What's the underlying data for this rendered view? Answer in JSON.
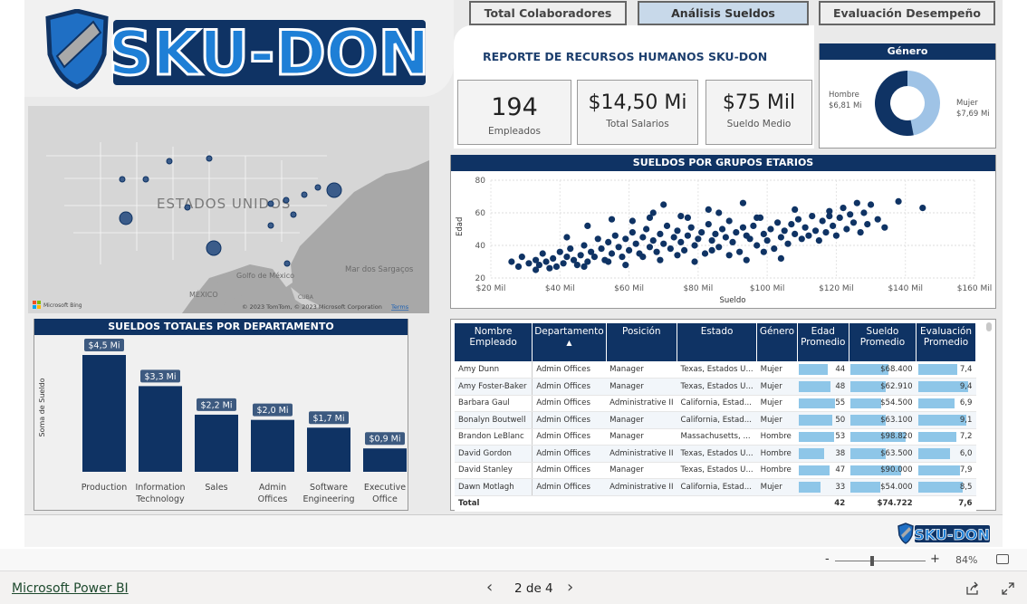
{
  "nav_tabs": [
    {
      "label": "Total Colaboradores",
      "active": false
    },
    {
      "label": "Análisis Sueldos",
      "active": true
    },
    {
      "label": "Evaluación Desempeño",
      "active": false
    }
  ],
  "logo": {
    "text": "SKU-DON"
  },
  "report_title": "REPORTE DE RECURSOS HUMANOS SKU-DON",
  "kpis": [
    {
      "value": "194",
      "label": "Empleados"
    },
    {
      "value": "$14,50 Mi",
      "label": "Total Salarios"
    },
    {
      "value": "$75 Mil",
      "label": "Sueldo Medio"
    }
  ],
  "map": {
    "country_label": "ESTADOS UNIDOS",
    "gulf_label": "Golfo de\nMéxico",
    "sea_label": "Mar dos Sargaços",
    "mexico_label": "MÉXICO",
    "cuba_label": "CUBA",
    "attribution": "© 2023 TomTom, © 2023 Microsoft Corporation",
    "terms_link": "Terms",
    "bing_label": "Microsoft Bing",
    "water_color": "#a8a8a8",
    "land_color": "#d6d6d6"
  },
  "gender_chart": {
    "title": "Género",
    "slices": [
      {
        "name": "Hombre",
        "value_label": "$6,81 Mi",
        "value": 6.81,
        "color": "#9fc3e6"
      },
      {
        "name": "Mujer",
        "value_label": "$7,69 Mi",
        "value": 7.69,
        "color": "#0f3364"
      }
    ]
  },
  "chart_data": [
    {
      "type": "scatter",
      "title": "SUELDOS POR GRUPOS ETARIOS",
      "xlabel": "Sueldo",
      "ylabel": "Edad",
      "xlim": [
        20000,
        160000
      ],
      "ylim": [
        20,
        80
      ],
      "x_tick_labels": [
        "$20 Mil",
        "$40 Mil",
        "$60 Mil",
        "$80 Mil",
        "$100 Mil",
        "$120 Mil",
        "$140 Mil",
        "$160 Mil"
      ],
      "y_tick_labels": [
        "20",
        "40",
        "60",
        "80"
      ],
      "grid": true,
      "points": [
        [
          26000,
          30
        ],
        [
          28000,
          27
        ],
        [
          29000,
          33
        ],
        [
          31000,
          29
        ],
        [
          33000,
          31
        ],
        [
          34000,
          28
        ],
        [
          35000,
          35
        ],
        [
          36000,
          30
        ],
        [
          38000,
          32
        ],
        [
          39000,
          27
        ],
        [
          40000,
          36
        ],
        [
          41000,
          29
        ],
        [
          42000,
          33
        ],
        [
          43000,
          38
        ],
        [
          44000,
          31
        ],
        [
          45000,
          28
        ],
        [
          46000,
          34
        ],
        [
          47000,
          40
        ],
        [
          48000,
          30
        ],
        [
          49000,
          36
        ],
        [
          50000,
          33
        ],
        [
          51000,
          44
        ],
        [
          52000,
          38
        ],
        [
          53000,
          31
        ],
        [
          54000,
          42
        ],
        [
          55000,
          35
        ],
        [
          56000,
          46
        ],
        [
          57000,
          39
        ],
        [
          58000,
          33
        ],
        [
          59000,
          44
        ],
        [
          60000,
          37
        ],
        [
          61000,
          48
        ],
        [
          62000,
          41
        ],
        [
          63000,
          35
        ],
        [
          64000,
          45
        ],
        [
          65000,
          50
        ],
        [
          66000,
          39
        ],
        [
          67000,
          43
        ],
        [
          68000,
          36
        ],
        [
          69000,
          47
        ],
        [
          70000,
          41
        ],
        [
          71000,
          52
        ],
        [
          72000,
          38
        ],
        [
          73000,
          45
        ],
        [
          74000,
          49
        ],
        [
          75000,
          42
        ],
        [
          76000,
          37
        ],
        [
          77000,
          46
        ],
        [
          78000,
          51
        ],
        [
          79000,
          40
        ],
        [
          80000,
          44
        ],
        [
          81000,
          48
        ],
        [
          82000,
          35
        ],
        [
          83000,
          53
        ],
        [
          84000,
          43
        ],
        [
          85000,
          47
        ],
        [
          86000,
          39
        ],
        [
          87000,
          50
        ],
        [
          88000,
          45
        ],
        [
          89000,
          55
        ],
        [
          90000,
          42
        ],
        [
          91000,
          48
        ],
        [
          92000,
          36
        ],
        [
          93000,
          51
        ],
        [
          94000,
          46
        ],
        [
          95000,
          44
        ],
        [
          96000,
          52
        ],
        [
          97000,
          40
        ],
        [
          98000,
          57
        ],
        [
          99000,
          47
        ],
        [
          100000,
          43
        ],
        [
          101000,
          50
        ],
        [
          102000,
          38
        ],
        [
          103000,
          54
        ],
        [
          104000,
          45
        ],
        [
          105000,
          49
        ],
        [
          106000,
          41
        ],
        [
          107000,
          53
        ],
        [
          108000,
          47
        ],
        [
          109000,
          56
        ],
        [
          110000,
          44
        ],
        [
          111000,
          51
        ],
        [
          112000,
          46
        ],
        [
          113000,
          58
        ],
        [
          114000,
          49
        ],
        [
          115000,
          43
        ],
        [
          116000,
          55
        ],
        [
          117000,
          48
        ],
        [
          118000,
          61
        ],
        [
          119000,
          52
        ],
        [
          120000,
          46
        ],
        [
          121000,
          57
        ],
        [
          122000,
          63
        ],
        [
          123000,
          50
        ],
        [
          124000,
          59
        ],
        [
          125000,
          54
        ],
        [
          126000,
          66
        ],
        [
          127000,
          48
        ],
        [
          128000,
          60
        ],
        [
          129000,
          53
        ],
        [
          130000,
          65
        ],
        [
          132000,
          56
        ],
        [
          134000,
          51
        ],
        [
          138000,
          67
        ],
        [
          145000,
          63
        ],
        [
          33000,
          25
        ],
        [
          37000,
          26
        ],
        [
          47000,
          27
        ],
        [
          54000,
          30
        ],
        [
          59000,
          28
        ],
        [
          64000,
          33
        ],
        [
          69000,
          31
        ],
        [
          74000,
          34
        ],
        [
          79000,
          30
        ],
        [
          84000,
          37
        ],
        [
          89000,
          34
        ],
        [
          94000,
          31
        ],
        [
          99000,
          36
        ],
        [
          104000,
          32
        ],
        [
          75000,
          58
        ],
        [
          83000,
          62
        ],
        [
          93000,
          66
        ],
        [
          70000,
          65
        ],
        [
          61000,
          55
        ],
        [
          66000,
          57
        ],
        [
          86000,
          60
        ],
        [
          97000,
          57
        ],
        [
          108000,
          62
        ],
        [
          118000,
          58
        ],
        [
          42000,
          45
        ],
        [
          48000,
          52
        ],
        [
          55000,
          56
        ],
        [
          67000,
          60
        ],
        [
          77000,
          57
        ]
      ]
    },
    {
      "type": "bar",
      "title": "SUELDOS TOTALES POR DEPARTAMENTO",
      "xlabel": "",
      "ylabel": "Soma de Sueldo",
      "categories": [
        "Production",
        "Information Technology",
        "Sales",
        "Admin Offices",
        "Software Engineering",
        "Executive Office"
      ],
      "values": [
        4.5,
        3.3,
        2.2,
        2.0,
        1.7,
        0.9
      ],
      "data_labels": [
        "$4,5 Mi",
        "$3,3 Mi",
        "$2,2 Mi",
        "$2,0 Mi",
        "$1,7 Mi",
        "$0,9 Mi"
      ],
      "ylim": [
        0,
        5
      ]
    }
  ],
  "table": {
    "headers": [
      "Nombre Empleado",
      "Departamento",
      "Posición",
      "Estado",
      "Género",
      "Edad Promedio",
      "Sueldo Promedio",
      "Evaluación Promedio"
    ],
    "sort_indicator": "▲",
    "rows": [
      {
        "name": "Amy Dunn",
        "dept": "Admin Offices",
        "pos": "Manager",
        "state": "Texas, Estados U...",
        "gender": "Mujer",
        "age": 44,
        "salary": "$68.400",
        "salary_n": 68400,
        "eval": "7,4",
        "eval_n": 7.4
      },
      {
        "name": "Amy Foster-Baker",
        "dept": "Admin Offices",
        "pos": "Manager",
        "state": "Texas, Estados U...",
        "gender": "Mujer",
        "age": 48,
        "salary": "$62.910",
        "salary_n": 62910,
        "eval": "9,4",
        "eval_n": 9.4
      },
      {
        "name": "Barbara Gaul",
        "dept": "Admin Offices",
        "pos": "Administrative II",
        "state": "California, Estad...",
        "gender": "Mujer",
        "age": 55,
        "salary": "$54.500",
        "salary_n": 54500,
        "eval": "6,9",
        "eval_n": 6.9
      },
      {
        "name": "Bonalyn Boutwell",
        "dept": "Admin Offices",
        "pos": "Manager",
        "state": "California, Estad...",
        "gender": "Mujer",
        "age": 50,
        "salary": "$63.100",
        "salary_n": 63100,
        "eval": "9,1",
        "eval_n": 9.1
      },
      {
        "name": "Brandon LeBlanc",
        "dept": "Admin Offices",
        "pos": "Manager",
        "state": "Massachusetts, ...",
        "gender": "Hombre",
        "age": 53,
        "salary": "$98.820",
        "salary_n": 98820,
        "eval": "7,2",
        "eval_n": 7.2
      },
      {
        "name": "David Gordon",
        "dept": "Admin Offices",
        "pos": "Administrative II",
        "state": "Texas, Estados U...",
        "gender": "Hombre",
        "age": 38,
        "salary": "$63.500",
        "salary_n": 63500,
        "eval": "6,0",
        "eval_n": 6.0
      },
      {
        "name": "David Stanley",
        "dept": "Admin Offices",
        "pos": "Manager",
        "state": "Texas, Estados U...",
        "gender": "Hombre",
        "age": 47,
        "salary": "$90.000",
        "salary_n": 90000,
        "eval": "7,9",
        "eval_n": 7.9
      },
      {
        "name": "Dawn Motlagh",
        "dept": "Admin Offices",
        "pos": "Administrative II",
        "state": "California, Estad...",
        "gender": "Mujer",
        "age": 33,
        "salary": "$54.000",
        "salary_n": 54000,
        "eval": "8,5",
        "eval_n": 8.5
      }
    ],
    "total": {
      "label": "Total",
      "age": "42",
      "salary": "$74.722",
      "eval": "7,6"
    }
  },
  "footer_logo": "SKU-DON",
  "zoom": {
    "minus": "-",
    "plus": "+",
    "value": "84%"
  },
  "bottom": {
    "app_link": "Microsoft Power BI",
    "page_indicator": "2 de 4",
    "prev": "‹",
    "next": "›"
  }
}
